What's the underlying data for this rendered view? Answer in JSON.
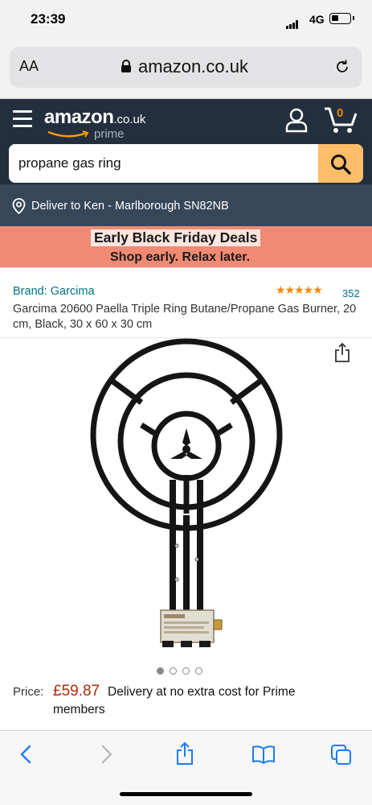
{
  "status": {
    "time": "23:39",
    "network": "4G"
  },
  "browser": {
    "aa_label": "AA",
    "url": "amazon.co.uk"
  },
  "header": {
    "logo_main": "amazon",
    "logo_suffix": ".co.uk",
    "logo_prime": "prime",
    "cart_count": "0",
    "search_value": "propane gas ring"
  },
  "delivery_bar": {
    "text": "Deliver to Ken - Marlborough SN82NB"
  },
  "banner": {
    "line1": "Early Black Friday Deals",
    "line2": "Shop early. Relax later."
  },
  "product": {
    "brand": "Brand: Garcima",
    "stars": "★★★★★",
    "rating_value": 4.5,
    "rating_count": "352",
    "title": "Garcima 20600 Paella Triple Ring Butane/Propane Gas Burner, 20 cm, Black, 30 x 60 x 30 cm",
    "image_count": 4,
    "active_image": 1
  },
  "price": {
    "label": "Price:",
    "value": "£59.87",
    "delivery_line1": "Delivery at no extra cost for Prime",
    "delivery_line2": "members"
  },
  "colors": {
    "header_bg": "#232f3e",
    "deliver_bg": "#37475a",
    "banner_bg": "#f18a72",
    "search_btn": "#febd69",
    "price": "#b12704",
    "link": "#007185",
    "star": "#f08804"
  }
}
